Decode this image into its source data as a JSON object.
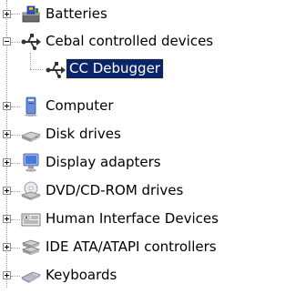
{
  "tree": {
    "items": [
      {
        "label": "Batteries",
        "icon": "battery-icon",
        "expanded": false
      },
      {
        "label": "Cebal controlled devices",
        "icon": "usb-icon",
        "expanded": true
      },
      {
        "label": "CC Debugger",
        "icon": "usb-icon",
        "selected": true
      },
      {
        "label": "Computer",
        "icon": "computer-icon",
        "expanded": false
      },
      {
        "label": "Disk drives",
        "icon": "disk-drive-icon",
        "expanded": false
      },
      {
        "label": "Display adapters",
        "icon": "display-adapter-icon",
        "expanded": false
      },
      {
        "label": "DVD/CD-ROM drives",
        "icon": "dvd-drive-icon",
        "expanded": false
      },
      {
        "label": "Human Interface Devices",
        "icon": "hid-icon",
        "expanded": false
      },
      {
        "label": "IDE ATA/ATAPI controllers",
        "icon": "ide-controller-icon",
        "expanded": false
      },
      {
        "label": "Keyboards",
        "icon": "keyboard-icon",
        "expanded": false
      }
    ]
  },
  "colors": {
    "selection_background": "#0a246a",
    "selection_text": "#ffffff",
    "tree_line": "#a0a0a0"
  }
}
